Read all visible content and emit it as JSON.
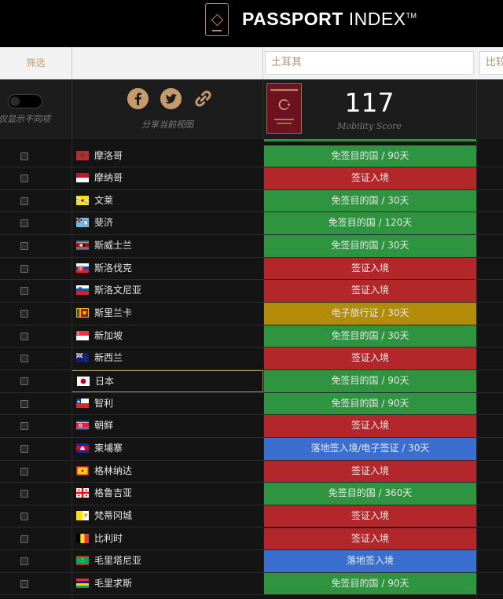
{
  "header": {
    "logo_bold": "PASSPORT",
    "logo_rest": " INDEX",
    "logo_tm": "TM"
  },
  "filters": {
    "filter_label": "筛选",
    "selected_passport": "土耳其",
    "compare_placeholder": "比较"
  },
  "controls": {
    "toggle_label": "仅显示不同项",
    "share_label": "分享当前视图"
  },
  "passport": {
    "score": "117",
    "score_label": "Mobility Score"
  },
  "colors": {
    "visa_free": "#2e9440",
    "visa_required": "#b3262a",
    "eta": "#b28b08",
    "visa_on_arrival": "#3a6fcf",
    "accent": "#c59b6e"
  },
  "rows": [
    {
      "country": "摩洛哥",
      "status": "免签目的国 / 90天",
      "kind": "green",
      "flag": "morocco"
    },
    {
      "country": "摩纳哥",
      "status": "签证入境",
      "kind": "red",
      "flag": "monaco"
    },
    {
      "country": "文莱",
      "status": "免签目的国 / 30天",
      "kind": "green",
      "flag": "brunei"
    },
    {
      "country": "斐济",
      "status": "免签目的国 / 120天",
      "kind": "green",
      "flag": "fiji"
    },
    {
      "country": "斯威士兰",
      "status": "免签目的国 / 30天",
      "kind": "green",
      "flag": "eswatini"
    },
    {
      "country": "斯洛伐克",
      "status": "签证入境",
      "kind": "red",
      "flag": "slovakia"
    },
    {
      "country": "斯洛文尼亚",
      "status": "签证入境",
      "kind": "red",
      "flag": "slovenia"
    },
    {
      "country": "斯里兰卡",
      "status": "电子旅行证 / 30天",
      "kind": "gold",
      "flag": "srilanka"
    },
    {
      "country": "新加坡",
      "status": "免签目的国 / 30天",
      "kind": "green",
      "flag": "singapore"
    },
    {
      "country": "新西兰",
      "status": "签证入境",
      "kind": "red",
      "flag": "newzealand"
    },
    {
      "country": "日本",
      "status": "免签目的国 / 90天",
      "kind": "green",
      "flag": "japan",
      "highlight": true
    },
    {
      "country": "智利",
      "status": "免签目的国 / 90天",
      "kind": "green",
      "flag": "chile"
    },
    {
      "country": "朝鲜",
      "status": "签证入境",
      "kind": "red",
      "flag": "northkorea"
    },
    {
      "country": "柬埔寨",
      "status": "落地签入境/电子签证 / 30天",
      "kind": "blue",
      "flag": "cambodia"
    },
    {
      "country": "格林纳达",
      "status": "签证入境",
      "kind": "red",
      "flag": "grenada"
    },
    {
      "country": "格鲁吉亚",
      "status": "免签目的国 / 360天",
      "kind": "green",
      "flag": "georgia"
    },
    {
      "country": "梵蒂冈城",
      "status": "签证入境",
      "kind": "red",
      "flag": "vatican"
    },
    {
      "country": "比利时",
      "status": "签证入境",
      "kind": "red",
      "flag": "belgium"
    },
    {
      "country": "毛里塔尼亚",
      "status": "落地签入境",
      "kind": "blue",
      "flag": "mauritania"
    },
    {
      "country": "毛里求斯",
      "status": "免签目的国 / 90天",
      "kind": "green",
      "flag": "mauritius"
    }
  ]
}
